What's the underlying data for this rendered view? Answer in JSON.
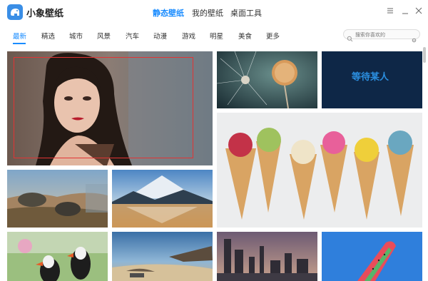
{
  "app": {
    "title": "小象壁纸"
  },
  "topnav": {
    "items": [
      "静态壁纸",
      "我的壁纸",
      "桌面工具"
    ],
    "active": "静态壁纸"
  },
  "window_controls": [
    "menu-icon",
    "minimize-icon",
    "close-icon"
  ],
  "categories": {
    "items": [
      "最新",
      "精选",
      "城市",
      "风景",
      "汽车",
      "动漫",
      "游戏",
      "明星",
      "美食",
      "更多"
    ],
    "active": "最新"
  },
  "search": {
    "placeholder": "搜索你喜欢的"
  },
  "tiles": {
    "tile_text": "等待某人"
  },
  "colors": {
    "accent": "#1a8cff",
    "selection": "#e23434"
  }
}
